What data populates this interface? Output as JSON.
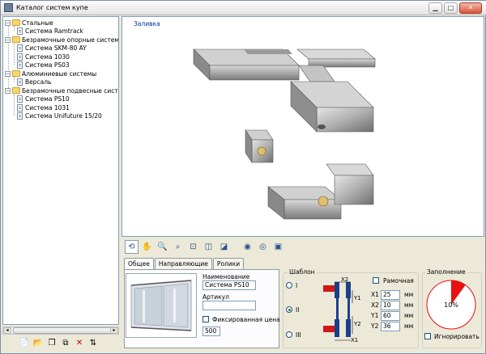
{
  "window": {
    "title": "Каталог систем купе"
  },
  "tree": {
    "items": [
      {
        "label": "Стальные",
        "type": "folder",
        "level": 0
      },
      {
        "label": "Система Ramtrack",
        "type": "doc",
        "level": 1
      },
      {
        "label": "Безрамочные опорные системы",
        "type": "folder",
        "level": 0
      },
      {
        "label": "Система SKM-80 AY",
        "type": "doc",
        "level": 1
      },
      {
        "label": "Система 1030",
        "type": "doc",
        "level": 1
      },
      {
        "label": "Система PS03",
        "type": "doc",
        "level": 1
      },
      {
        "label": "Алюминиевые системы",
        "type": "folder",
        "level": 0
      },
      {
        "label": "Версаль",
        "type": "doc",
        "level": 1
      },
      {
        "label": "Безрамочные подвесные системы",
        "type": "folder",
        "level": 0
      },
      {
        "label": "Система PS10",
        "type": "doc",
        "level": 1
      },
      {
        "label": "Система 1031",
        "type": "doc",
        "level": 1
      },
      {
        "label": "Система Unifuture 15/20",
        "type": "doc",
        "level": 1
      }
    ]
  },
  "left_toolbar": [
    {
      "name": "new-icon",
      "glyph": "📄"
    },
    {
      "name": "open-folder-icon",
      "glyph": "📂"
    },
    {
      "name": "copy-icon",
      "glyph": "❐"
    },
    {
      "name": "duplicate-icon",
      "glyph": "⧉"
    },
    {
      "name": "delete-icon",
      "glyph": "✕",
      "color": "#cc0000"
    },
    {
      "name": "sort-icon",
      "glyph": "⇅"
    }
  ],
  "view": {
    "label": "Заливка"
  },
  "view_toolbar": [
    {
      "name": "rotate-icon",
      "glyph": "⟲"
    },
    {
      "name": "pan-hand-icon",
      "glyph": "✋"
    },
    {
      "name": "zoom-icon",
      "glyph": "🔍"
    },
    {
      "name": "zoom-window-icon",
      "glyph": "⌕"
    },
    {
      "name": "zoom-extents-icon",
      "glyph": "⊡"
    },
    {
      "name": "view-front-icon",
      "glyph": "◫"
    },
    {
      "name": "view-side-icon",
      "glyph": "◪"
    },
    {
      "name": "render-shaded-icon",
      "glyph": "◉"
    },
    {
      "name": "render-wire-icon",
      "glyph": "◎"
    },
    {
      "name": "render-texture-icon",
      "glyph": "▣"
    }
  ],
  "tabs": [
    {
      "label": "Общее",
      "selected": true
    },
    {
      "label": "Направляющие",
      "selected": false
    },
    {
      "label": "Ролики",
      "selected": false
    }
  ],
  "form": {
    "name_label": "Наименование",
    "name_value": "Система PS10",
    "article_label": "Артикул",
    "article_value": "",
    "fixed_price_label": "Фиксированная цена",
    "fixed_price_checked": false,
    "price_value": "500"
  },
  "template": {
    "group_title": "Шаблон",
    "options": [
      {
        "label": "I",
        "selected": false
      },
      {
        "label": "II",
        "selected": true
      },
      {
        "label": "III",
        "selected": false
      }
    ],
    "frame_label": "Рамочная",
    "frame_checked": false,
    "dims": [
      {
        "label": "X1",
        "value": "25",
        "unit": "мм"
      },
      {
        "label": "X2",
        "value": "10",
        "unit": "мм"
      },
      {
        "label": "Y1",
        "value": "60",
        "unit": "мм"
      },
      {
        "label": "Y2",
        "value": "36",
        "unit": "мм"
      }
    ],
    "diagram_labels": {
      "x2": "X2",
      "y1": "Y1",
      "y2": "Y2",
      "x1": "X1"
    }
  },
  "fill": {
    "group_title": "Заполнение",
    "percent_label": "10%",
    "fraction": 0.1,
    "color": "#e81010",
    "ignore_label": "Игнорировать",
    "ignore_checked": false
  }
}
